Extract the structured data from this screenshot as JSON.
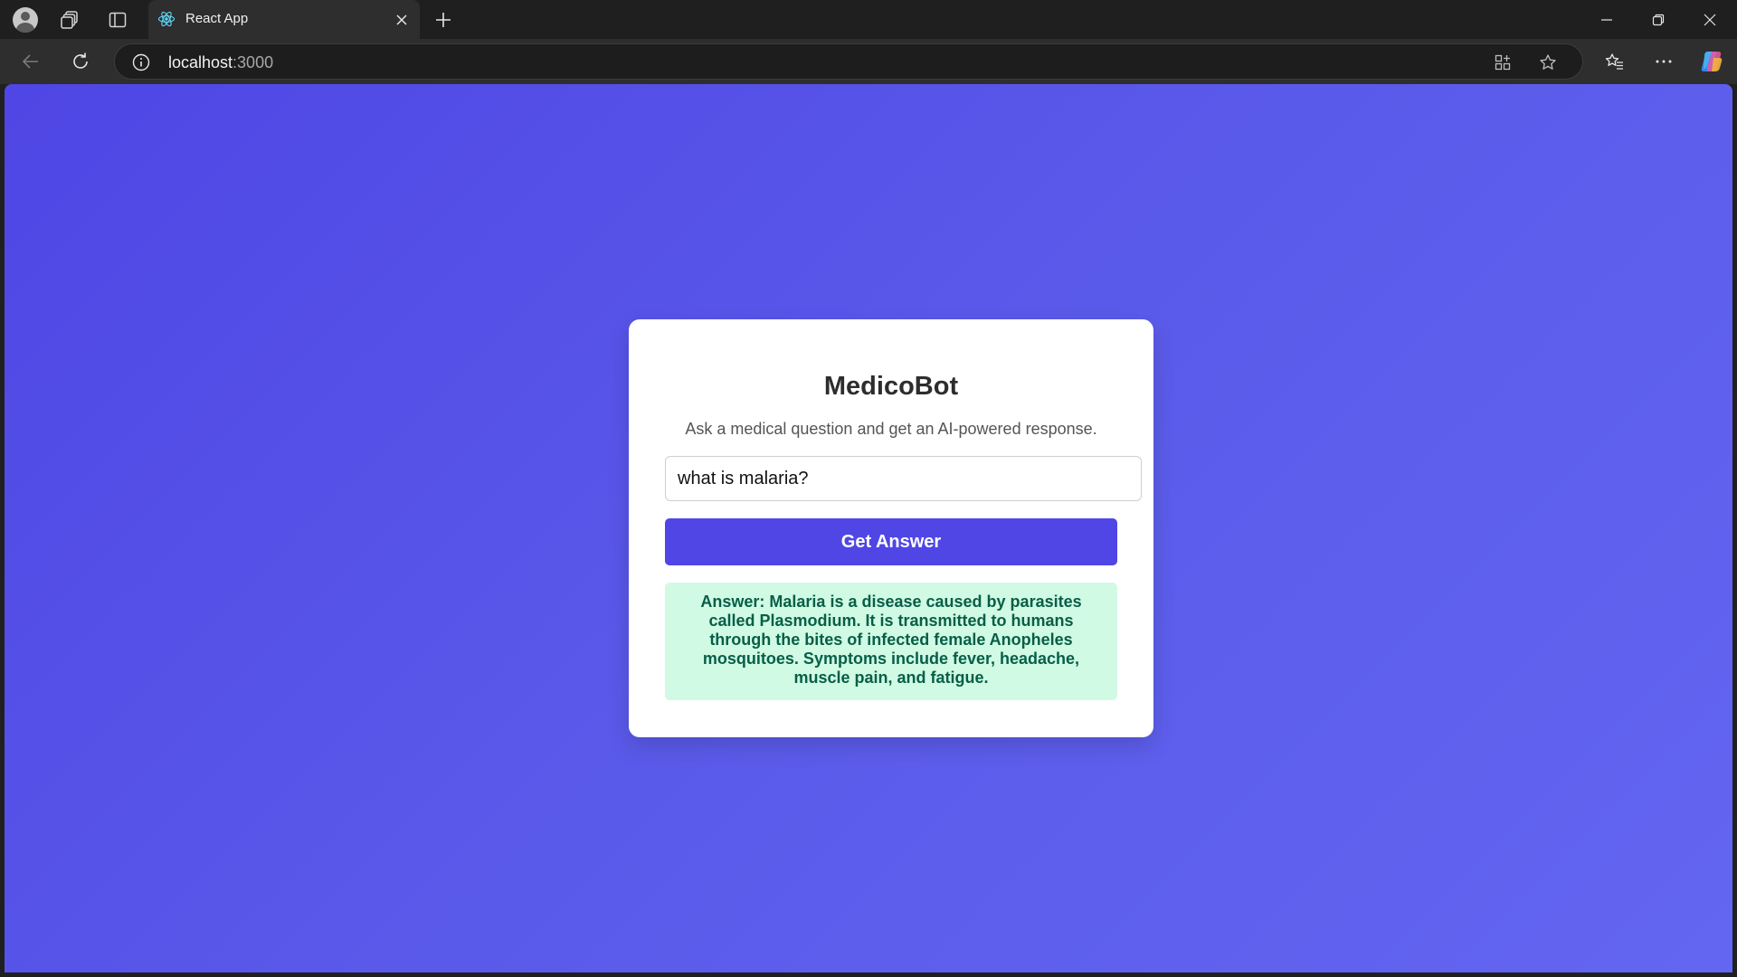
{
  "browser": {
    "tab": {
      "title": "React App",
      "favicon": "react-logo-icon"
    },
    "address": {
      "host": "localhost",
      "port": ":3000"
    },
    "icons": {
      "profile": "profile-avatar",
      "workspaces": "workspaces-icon",
      "sidebar": "vertical-tabs-icon",
      "tab_close": "close-icon",
      "new_tab": "plus-icon",
      "back": "back-arrow-icon",
      "refresh": "refresh-icon",
      "site_info": "info-icon",
      "app_available": "apps-icon",
      "favorite": "star-icon",
      "favorites": "favorites-list-icon",
      "more": "more-icon",
      "copilot": "copilot-icon",
      "minimize": "minimize-icon",
      "restore": "restore-icon",
      "close_window": "close-icon"
    }
  },
  "app": {
    "title": "MedicoBot",
    "subtitle": "Ask a medical question and get an AI-powered response.",
    "question_value": "what is malaria?",
    "submit_label": "Get Answer",
    "answer_prefix": "Answer:",
    "answer_text": "Malaria is a disease caused by parasites called Plasmodium. It is transmitted to humans through the bites of infected female Anopheles mosquitoes. Symptoms include fever, headache, muscle pain, and fatigue."
  },
  "colors": {
    "background_start": "#4f46e5",
    "background_end": "#6366f1",
    "button": "#4f46e5",
    "answer_bg": "#d1fae5",
    "answer_text": "#065f46"
  }
}
